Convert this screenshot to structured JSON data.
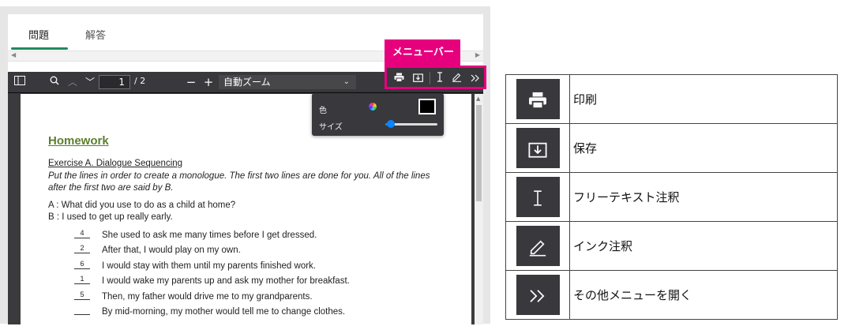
{
  "tabs": [
    {
      "label": "問題",
      "active": true
    },
    {
      "label": "解答",
      "active": false
    }
  ],
  "toolbar": {
    "page_current": "1",
    "page_total": "/ 2",
    "zoom_label": "自動ズーム",
    "zoom_minus": "−",
    "zoom_plus": "+"
  },
  "document": {
    "title": "Homework",
    "exercise_heading": "Exercise A. Dialogue Sequencing",
    "instructions": "Put the lines in order to create a monologue. The first two lines are done for you. All of the lines after the first two are said by B.",
    "dialogue": [
      "A : What did you use to do as a child at home?",
      "B : I used to get up really early."
    ],
    "items": [
      {
        "num": "4",
        "text": "She used to ask me many times before I get dressed."
      },
      {
        "num": "2",
        "text": "After that, I would play on my own."
      },
      {
        "num": "6",
        "text": "I would stay with them until my parents finished work."
      },
      {
        "num": "1",
        "text": "I would wake my parents up and ask my mother for breakfast."
      },
      {
        "num": "5",
        "text": "Then, my father would drive me to my grandparents."
      },
      {
        "num": "",
        "text": "By mid-morning, my mother would tell me to change clothes."
      }
    ]
  },
  "popup": {
    "color_label": "色",
    "size_label": "サイズ",
    "swatch_color": "#000000",
    "size_level": 0.1
  },
  "menu_callout": {
    "label": "メニューバー",
    "accent": "#e6007e"
  },
  "legend": [
    {
      "icon": "print-icon",
      "label": "印刷"
    },
    {
      "icon": "save-icon",
      "label": "保存"
    },
    {
      "icon": "text-cursor-icon",
      "label": "フリーテキスト注釈"
    },
    {
      "icon": "pen-icon",
      "label": "インク注釈"
    },
    {
      "icon": "double-chevron-icon",
      "label": "その他メニューを開く"
    }
  ]
}
